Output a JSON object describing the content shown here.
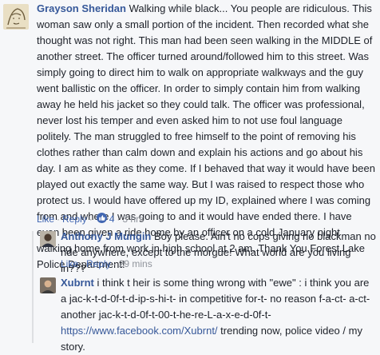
{
  "main_comment": {
    "author": "Grayson Sheridan",
    "text": "Walking while black... You people are ridiculous. This woman saw only a small portion of the incident. Then recorded what she thought was not right. This man had been seen walking in the MIDDLE of another street. The officer turned around/followed him to this street. Was simply going to direct him to walk on appropriate walkways and the guy went ballistic on the officer. In order to simply contain him from walking away he held his jacket so they could talk. The officer was professional, never lost his temper and even asked him to not use foul language politely. The man struggled to free himself to the point of removing his clothes rather than calm down and explain his actions and go about his day. I am as white as they come. If I behaved that way it would have been played out exactly the same way. But I was raised to respect those who protect us. I would have offered up my ID, explained where I was coming from and where I was going to and it would have ended there. I have even been given a ride home by an officer on a cold January night walking home from work in high school at 2 am. Thank You Forest Lake Police Department!",
    "like": "Like",
    "reply": "Reply",
    "reaction_count": "4",
    "time": "3 hrs",
    "reaction_icon": "like-icon",
    "reaction_color": "#4267b2"
  },
  "replies": [
    {
      "author": "Anthony J Mungin",
      "text": "Boy please. Ain't no cops giving no blackman no ride anywhere, except to the morgue! What world are you living in???",
      "like": "Like",
      "reply": "Reply",
      "time": "29 mins"
    },
    {
      "author": "Xubrnt",
      "text": "i think t heir is some thing wrong with \"ewe\" : i think you are a jac-k-t-d-0f-t-d-ip-s-hi-t- in competitive for-t- no reason f-a-ct- a-ct- another jac-k-t-d-0f-t-00-t-he-re-L-a-x-e-d-0f-t-",
      "link": "https://www.facebook.com/Xubrnt/",
      "text_after": "trending now, police video / my story."
    }
  ],
  "colors": {
    "author": "#365899",
    "link": "#4267b2",
    "meta": "#90949c",
    "background": "#f6f7f9"
  }
}
